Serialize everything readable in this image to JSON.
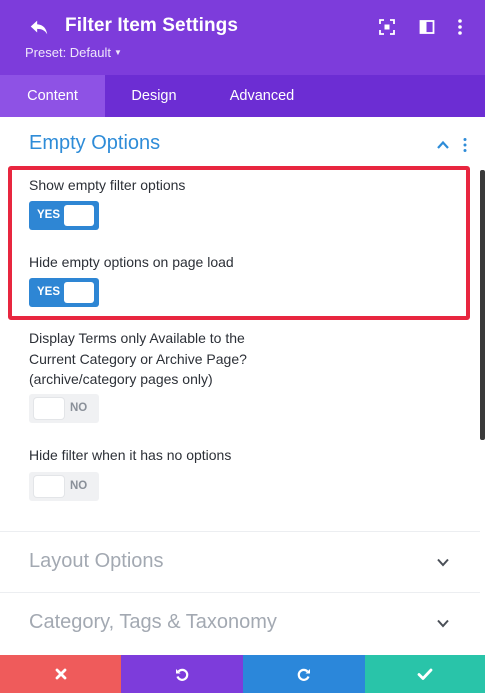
{
  "header": {
    "title": "Filter Item Settings",
    "preset_label": "Preset: Default",
    "icons": [
      "back-icon",
      "expand-icon",
      "sidebar-layout-icon",
      "more-vertical-icon"
    ]
  },
  "tabs": [
    {
      "label": "Content",
      "active": true
    },
    {
      "label": "Design",
      "active": false
    },
    {
      "label": "Advanced",
      "active": false
    }
  ],
  "sections": {
    "empty_options": {
      "title": "Empty Options",
      "expanded": true,
      "settings": [
        {
          "label": "Show empty filter options",
          "toggle": "YES"
        },
        {
          "label": "Hide empty options on page load",
          "toggle": "YES"
        },
        {
          "label_lines": [
            "Display Terms only Available to the",
            "Current Category or Archive Page?",
            "(archive/category pages only)"
          ],
          "toggle": "NO"
        },
        {
          "label": "Hide filter when it has no options",
          "toggle": "NO"
        }
      ]
    },
    "layout_options": {
      "title": "Layout Options",
      "expanded": false
    },
    "taxonomy": {
      "title": "Category, Tags & Taxonomy",
      "expanded": false
    }
  },
  "footer": {
    "buttons": [
      {
        "action": "discard",
        "icon": "close-icon",
        "color": "#ef5b5b"
      },
      {
        "action": "undo",
        "icon": "undo-icon",
        "color": "#7d3cdb"
      },
      {
        "action": "redo",
        "icon": "redo-icon",
        "color": "#2b87da"
      },
      {
        "action": "save",
        "icon": "check-icon",
        "color": "#29c4a9"
      }
    ]
  },
  "colors": {
    "header_purple": "#7d3cdb",
    "tab_bar_purple": "#6c2dd3",
    "active_tab_purple": "#8e52e5",
    "section_blue": "#2e8cd8",
    "toggle_on_blue": "#2e86d4",
    "highlight_red": "#e8263f"
  }
}
